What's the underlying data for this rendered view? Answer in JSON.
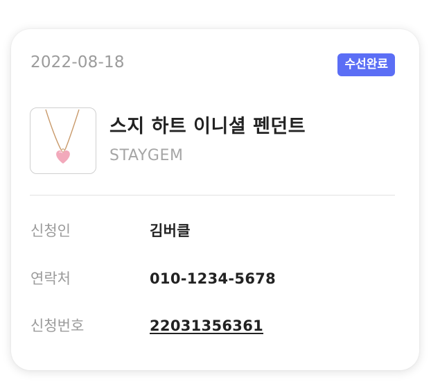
{
  "order": {
    "date": "2022-08-18",
    "status_label": "수선완료",
    "status_color": "#5b6ef5"
  },
  "product": {
    "name": "스지 하트 이니셜 펜던트",
    "brand": "STAYGEM",
    "thumbnail": "heart-pendant-necklace-image"
  },
  "details": {
    "applicant": {
      "label": "신청인",
      "value": "김버클"
    },
    "contact": {
      "label": "연락처",
      "value": "010-1234-5678"
    },
    "request_number": {
      "label": "신청번호",
      "value": "22031356361"
    }
  }
}
